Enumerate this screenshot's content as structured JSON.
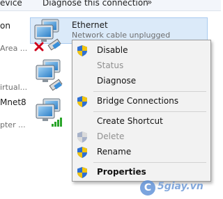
{
  "toolbar": {
    "item1": "evice",
    "item2": "Diagnose this connection",
    "more": "»"
  },
  "left_fragments": {
    "a": "on",
    "b": "Area ...",
    "c": "irtual...",
    "d": "Mnet8",
    "e": "pter ..."
  },
  "adapters": [
    {
      "name": "Ethernet",
      "status": "Network cable unplugged"
    }
  ],
  "context_menu": {
    "items": [
      {
        "label": "Disable",
        "enabled": true,
        "icon": "shield-icon"
      },
      {
        "label": "Status",
        "enabled": false
      },
      {
        "label": "Diagnose",
        "enabled": true
      },
      {
        "label": "Bridge Connections",
        "enabled": true,
        "icon": "shield-icon"
      },
      {
        "label": "Create Shortcut",
        "enabled": true
      },
      {
        "label": "Delete",
        "enabled": false,
        "icon": "shield-icon"
      },
      {
        "label": "Rename",
        "enabled": true,
        "icon": "shield-icon"
      },
      {
        "label": "Properties",
        "enabled": true,
        "icon": "shield-icon",
        "default": true
      }
    ]
  },
  "watermark": {
    "logo": "C",
    "text": "5giay.vn"
  },
  "colors": {
    "selection_bg": "#dbeaf9",
    "selection_border": "#a9cbf0",
    "menu_bg": "#f2f2f2"
  }
}
